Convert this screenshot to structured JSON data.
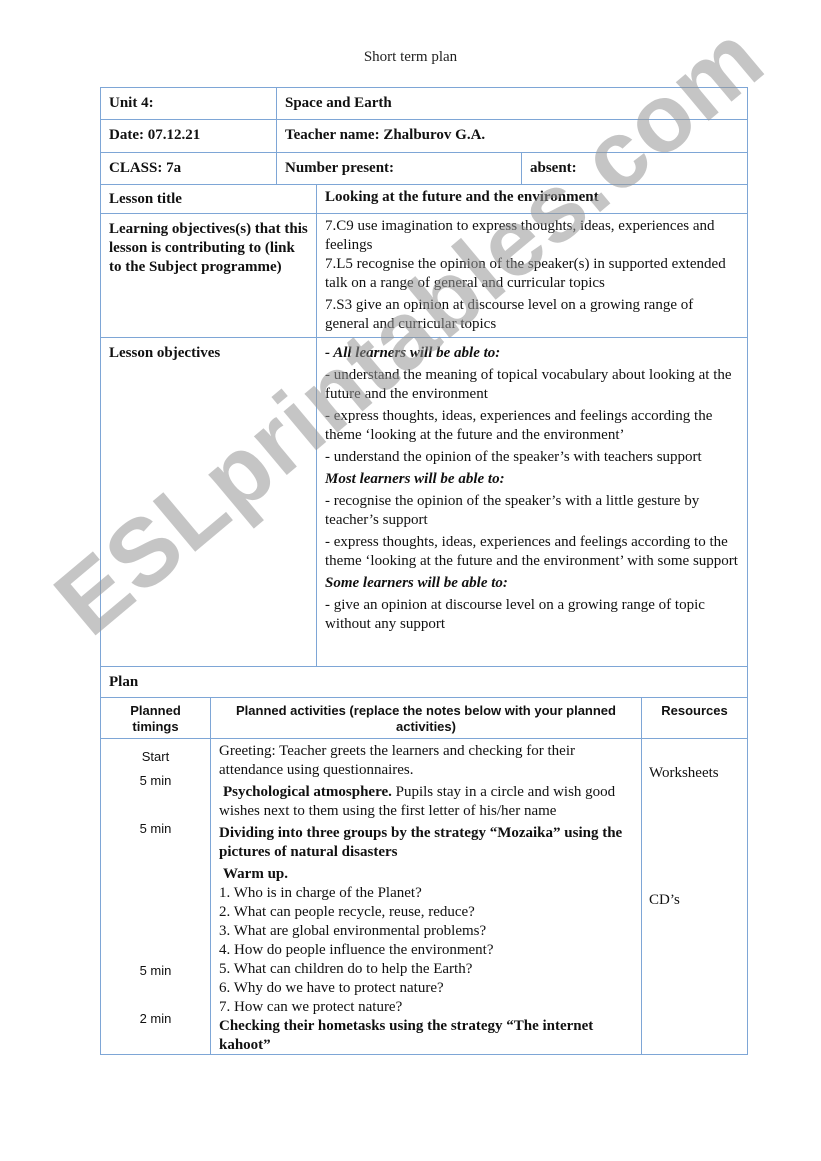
{
  "document": {
    "title": "Short term plan",
    "watermark": "ESLprintables.com",
    "border_color": "#7ea6d6"
  },
  "header": {
    "unit_label": "Unit 4:",
    "unit_value": "Space and Earth",
    "date_label": "Date: 07.12.21",
    "teacher_label": "Teacher name: Zhalburov G.A.",
    "class_label": "CLASS: 7a",
    "present_label": "Number present:",
    "absent_label": "absent:",
    "lesson_title_label": "Lesson title",
    "lesson_title_value": "Looking at the future and the environment"
  },
  "learning_objectives": {
    "label": "Learning objectives(s) that this lesson is contributing to (link to the Subject programme)",
    "items": [
      "7.C9 use imagination to express thoughts, ideas, experiences and feelings",
      "7.L5 recognise the opinion of the speaker(s) in supported extended talk on a range of general and curricular topics",
      "7.S3 give an opinion at discourse level on a growing range of general and curricular topics"
    ]
  },
  "lesson_objectives": {
    "label": "Lesson objectives",
    "all_heading": "- All learners will be able to:",
    "all_items": [
      "- understand the meaning of topical vocabulary about looking at the future and the environment",
      "-  express thoughts, ideas, experiences and feelings according the theme ‘looking at the future and the environment’",
      "- understand the opinion of the speaker’s with teachers support"
    ],
    "most_heading": "Most learners will be able to:",
    "most_items": [
      "- recognise the opinion of the speaker’s with a little gesture by teacher’s support",
      "- express thoughts, ideas, experiences and feelings according to the theme ‘looking at the future and the environment’ with some support"
    ],
    "some_heading": "Some learners will be able to:",
    "some_items": [
      "- give an opinion at discourse level on a growing range of topic without any support"
    ]
  },
  "plan": {
    "label": "Plan",
    "columns": {
      "timings": "Planned timings",
      "activities": "Planned activities (replace the notes below with your planned activities)",
      "resources": "Resources"
    },
    "timings": [
      "Start",
      "5 min",
      "5 min",
      "5 min",
      "2 min"
    ],
    "activities": {
      "greeting": "Greeting: Teacher greets the learners and checking for their attendance using questionnaires.",
      "psych_bold": "Psychological atmosphere.",
      "psych_text": " Pupils stay in a circle and wish good wishes next to them using the first letter of his/her name",
      "dividing": "Dividing into three groups  by the strategy “Mozaika” using the pictures of natural disasters",
      "warmup_heading": "Warm up.",
      "questions": [
        "1. Who is in charge of the Planet?",
        "2. What can people recycle, reuse, reduce?",
        "3. What are global environmental problems?",
        "4. How do people influence the environment?",
        "5. What can children do to help the Earth?",
        "6. Why do we have to protect nature?",
        "7. How can we protect nature?"
      ],
      "checking": "Checking their hometasks using the strategy “The internet kahoot”"
    },
    "resources": [
      "Worksheets",
      "CD’s"
    ]
  }
}
